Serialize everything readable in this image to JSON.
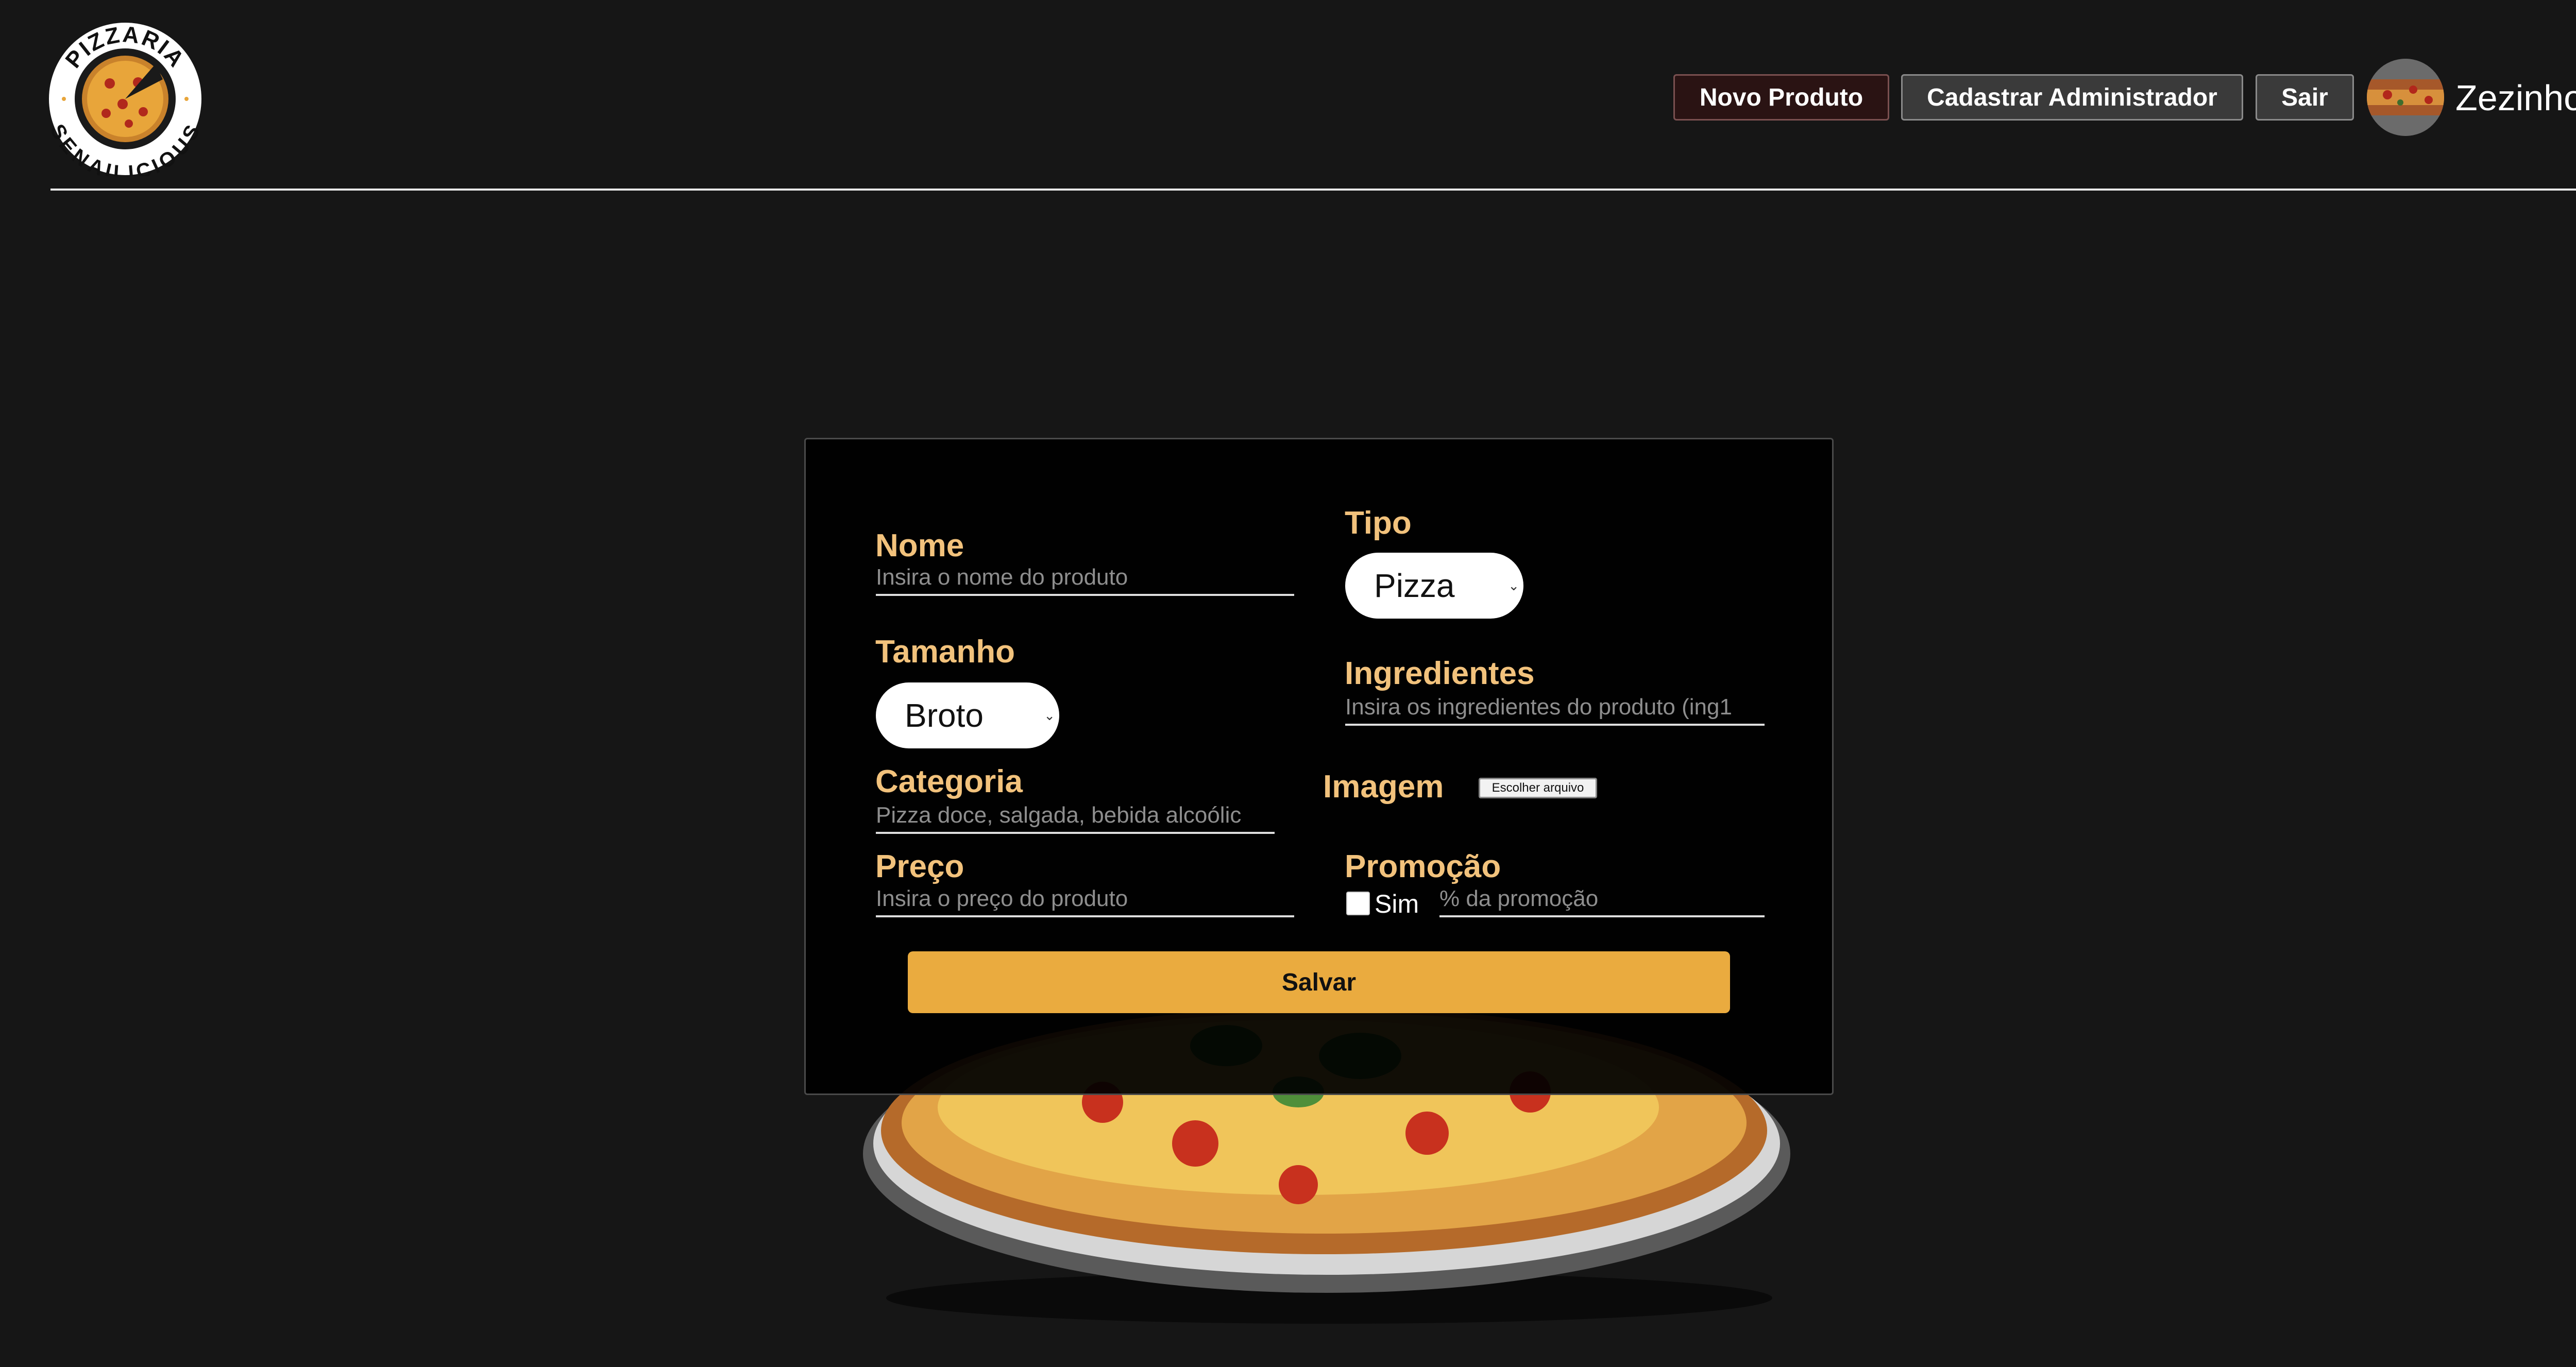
{
  "header": {
    "logo": {
      "top_text": "PIZZARIA",
      "bottom_text": "SENAILICIOUS"
    },
    "buttons": {
      "new_product": "Novo Produto",
      "register_admin": "Cadastrar Administrador",
      "logout": "Sair"
    },
    "user": {
      "name": "Zezinho"
    }
  },
  "form": {
    "nome": {
      "label": "Nome",
      "placeholder": "Insira o nome do produto"
    },
    "tipo": {
      "label": "Tipo",
      "selected": "Pizza"
    },
    "tamanho": {
      "label": "Tamanho",
      "selected": "Broto"
    },
    "ingredientes": {
      "label": "Ingredientes",
      "placeholder": "Insira os ingredientes do produto (ing1"
    },
    "categoria": {
      "label": "Categoria",
      "placeholder": "Pizza doce, salgada, bebida alcoólic"
    },
    "imagem": {
      "label": "Imagem",
      "file_button": "Escolher arquivo"
    },
    "preco": {
      "label": "Preço",
      "placeholder": "Insira o preço do produto"
    },
    "promocao": {
      "label": "Promoção",
      "checkbox_label": "Sim",
      "percent_placeholder": "% da promoção"
    },
    "submit": "Salvar"
  },
  "colors": {
    "background": "#161616",
    "label": "#f2c27c",
    "accent_button": "#eaab3f",
    "card": "#000000"
  },
  "icons": {
    "logo": "pizza-logo",
    "avatar": "pizza-avatar",
    "select_arrow": "chevron-down-icon",
    "background_image": "pizza-image"
  }
}
